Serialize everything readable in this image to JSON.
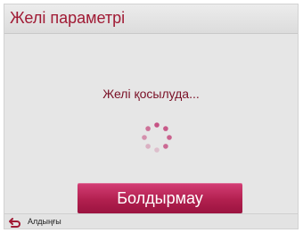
{
  "dialog": {
    "title": "Желі параметрі",
    "status_text": "Желі қосылуда...",
    "cancel_label": "Болдырмау",
    "loading_icon": "spinner-icon"
  },
  "footer": {
    "back_label": "Алдыңғы",
    "back_icon": "return-arrow-icon"
  },
  "colors": {
    "title": "#a01a34",
    "status_text": "#7a1026",
    "button_top": "#d43e76",
    "button_bottom": "#9b1340",
    "dialog_bg": "#e6e6e6",
    "spinner": "#c44a7e"
  }
}
